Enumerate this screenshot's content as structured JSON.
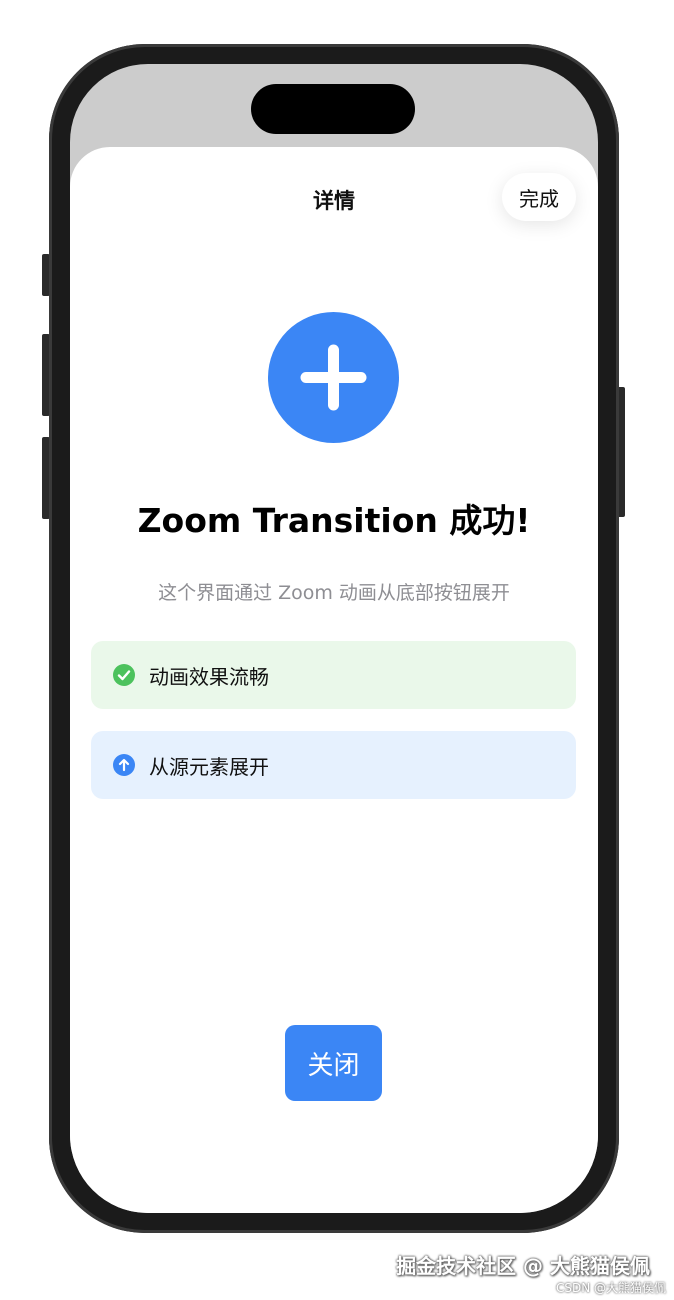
{
  "nav": {
    "title": "详情",
    "done_label": "完成"
  },
  "hero": {
    "icon": "plus-icon",
    "accent_color": "#3b86f5"
  },
  "headline": "Zoom Transition 成功!",
  "subtitle": "这个界面通过 Zoom 动画从底部按钮展开",
  "features": [
    {
      "icon": "checkmark-circle-icon",
      "label": "动画效果流畅",
      "color": "#4cc25d",
      "background": "#eaf8ea"
    },
    {
      "icon": "arrow-up-circle-icon",
      "label": "从源元素展开",
      "color": "#3b86f5",
      "background": "#e6f1fe"
    }
  ],
  "close_label": "关闭",
  "watermark": {
    "main": "掘金技术社区 @ 大熊猫侯佩",
    "sub": "CSDN @大熊猫侯佩"
  }
}
